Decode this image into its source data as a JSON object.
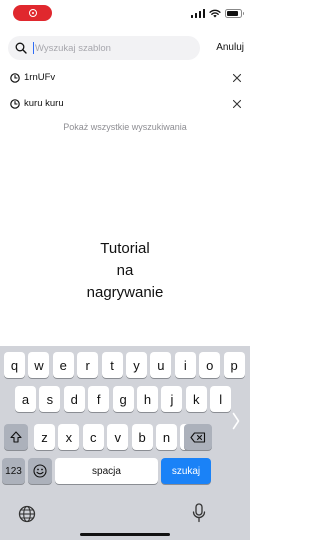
{
  "search": {
    "placeholder": "Wyszukaj szablon",
    "value": "",
    "cancel_label": "Anuluj"
  },
  "history": {
    "items": [
      {
        "label": "1rnUFv"
      },
      {
        "label": "kuru kuru"
      }
    ],
    "show_all_label": "Pokaż wszystkie wyszukiwania"
  },
  "center": {
    "line1": "Tutorial",
    "line2": "na",
    "line3": "nagrywanie"
  },
  "keyboard": {
    "row1": [
      "q",
      "w",
      "e",
      "r",
      "t",
      "y",
      "u",
      "i",
      "o",
      "p"
    ],
    "row2": [
      "a",
      "s",
      "d",
      "f",
      "g",
      "h",
      "j",
      "k",
      "l"
    ],
    "row3": [
      "z",
      "x",
      "c",
      "v",
      "b",
      "n",
      "m"
    ],
    "numbers_label": "123",
    "space_label": "spacja",
    "return_label": "szukaj"
  },
  "status_bar": {
    "battery_level": 0.85,
    "recording": true
  },
  "icons": {
    "recording": "record-icon",
    "signal": "cellular-signal-icon",
    "wifi": "wifi-icon",
    "battery": "battery-icon",
    "search": "search-icon",
    "history": "clock-icon",
    "remove": "close-icon",
    "shift": "shift-icon",
    "delete": "backspace-icon",
    "emoji": "emoji-icon",
    "globe": "globe-icon",
    "dictation": "microphone-icon"
  },
  "colors": {
    "recording": "#e0282e",
    "accent": "#1a82f7",
    "keyboard_bg": "#d1d3d9",
    "caret": "#2f6cf6"
  }
}
